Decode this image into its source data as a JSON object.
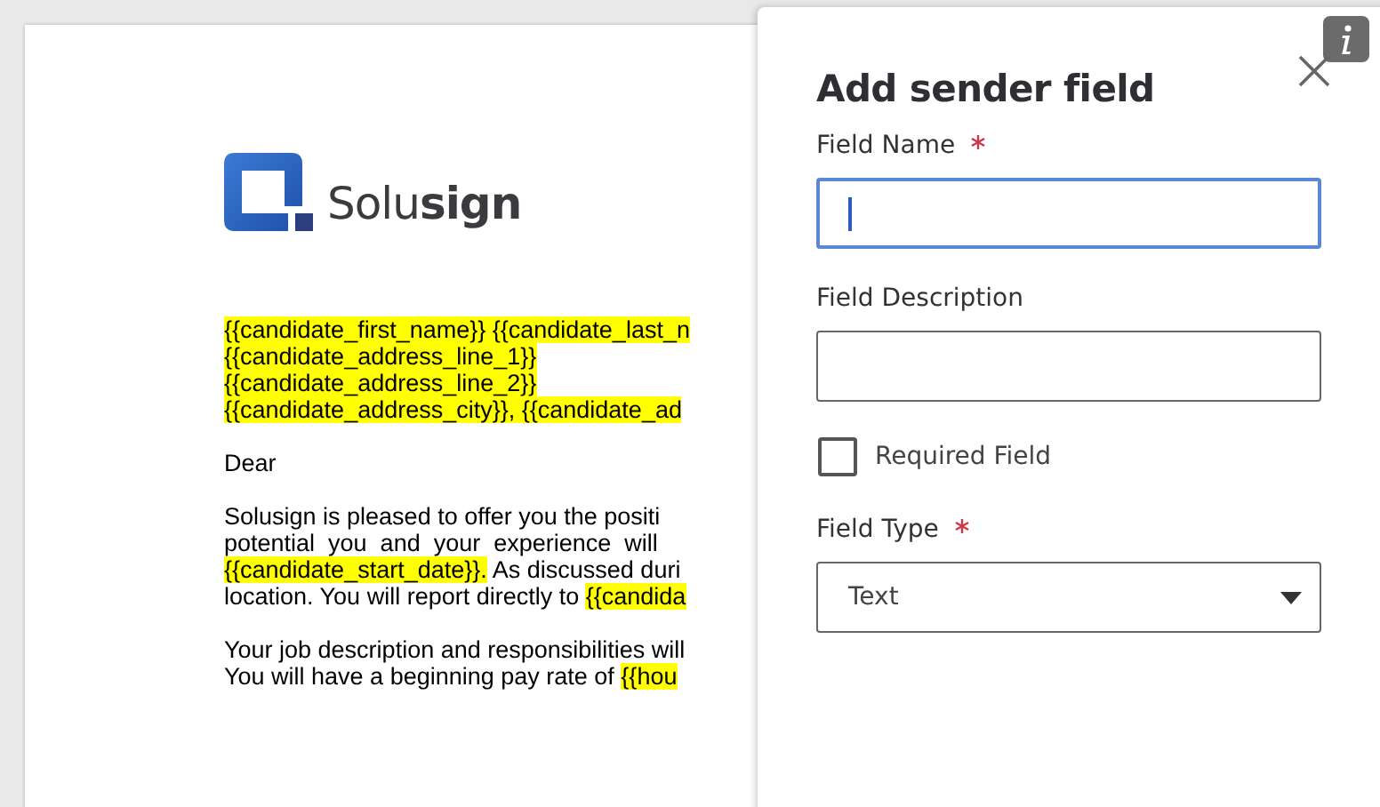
{
  "document": {
    "logo": "Solu**sign**",
    "paragraphs": [
      {
        "lines": [
          {
            "segments": [
              {
                "text": "{{candidate_first_name}} {{candidate_last_n",
                "highlighted": true
              }
            ]
          },
          {
            "segments": [
              {
                "text": "{{candidate_address_line_1}}",
                "highlighted": true
              }
            ]
          },
          {
            "segments": [
              {
                "text": "{{candidate_address_line_2}}",
                "highlighted": true
              }
            ]
          },
          {
            "segments": [
              {
                "text": "{{candidate_address_city}}, {{candidate_ad",
                "highlighted": true
              }
            ]
          }
        ]
      },
      {
        "lines": [
          {
            "segments": [
              {
                "text": "Dear",
                "highlighted": false
              }
            ]
          }
        ]
      },
      {
        "lines": [
          {
            "segments": [
              {
                "text": "Solusign is pleased to offer you the positi",
                "highlighted": false
              }
            ]
          },
          {
            "segments": [
              {
                "text": "potential  you  and  your  experience  will",
                "highlighted": false
              }
            ]
          },
          {
            "segments": [
              {
                "text": "{{candidate_start_date}}.",
                "highlighted": true
              },
              {
                "text": " As discussed duri",
                "highlighted": false
              }
            ]
          },
          {
            "segments": [
              {
                "text": "location. You will report directly to ",
                "highlighted": false
              },
              {
                "text": "{{candida",
                "highlighted": true
              }
            ]
          }
        ]
      },
      {
        "lines": [
          {
            "segments": [
              {
                "text": "Your job description and responsibilities will",
                "highlighted": false
              }
            ]
          },
          {
            "segments": [
              {
                "text": "You will have a beginning pay rate of ",
                "highlighted": false
              },
              {
                "text": "{{hou",
                "highlighted": true
              }
            ]
          }
        ]
      }
    ]
  },
  "panel": {
    "title": "Add sender field",
    "fields": [
      {
        "kind": "text",
        "label": "Field Name",
        "required": true,
        "focused": true
      },
      {
        "kind": "text",
        "label": "Field Description",
        "required": false,
        "focused": false
      },
      {
        "kind": "checkbox",
        "label": "Required Field",
        "checked": false
      },
      {
        "kind": "select",
        "label": "Field Type",
        "required": true,
        "value": "Text"
      }
    ]
  }
}
